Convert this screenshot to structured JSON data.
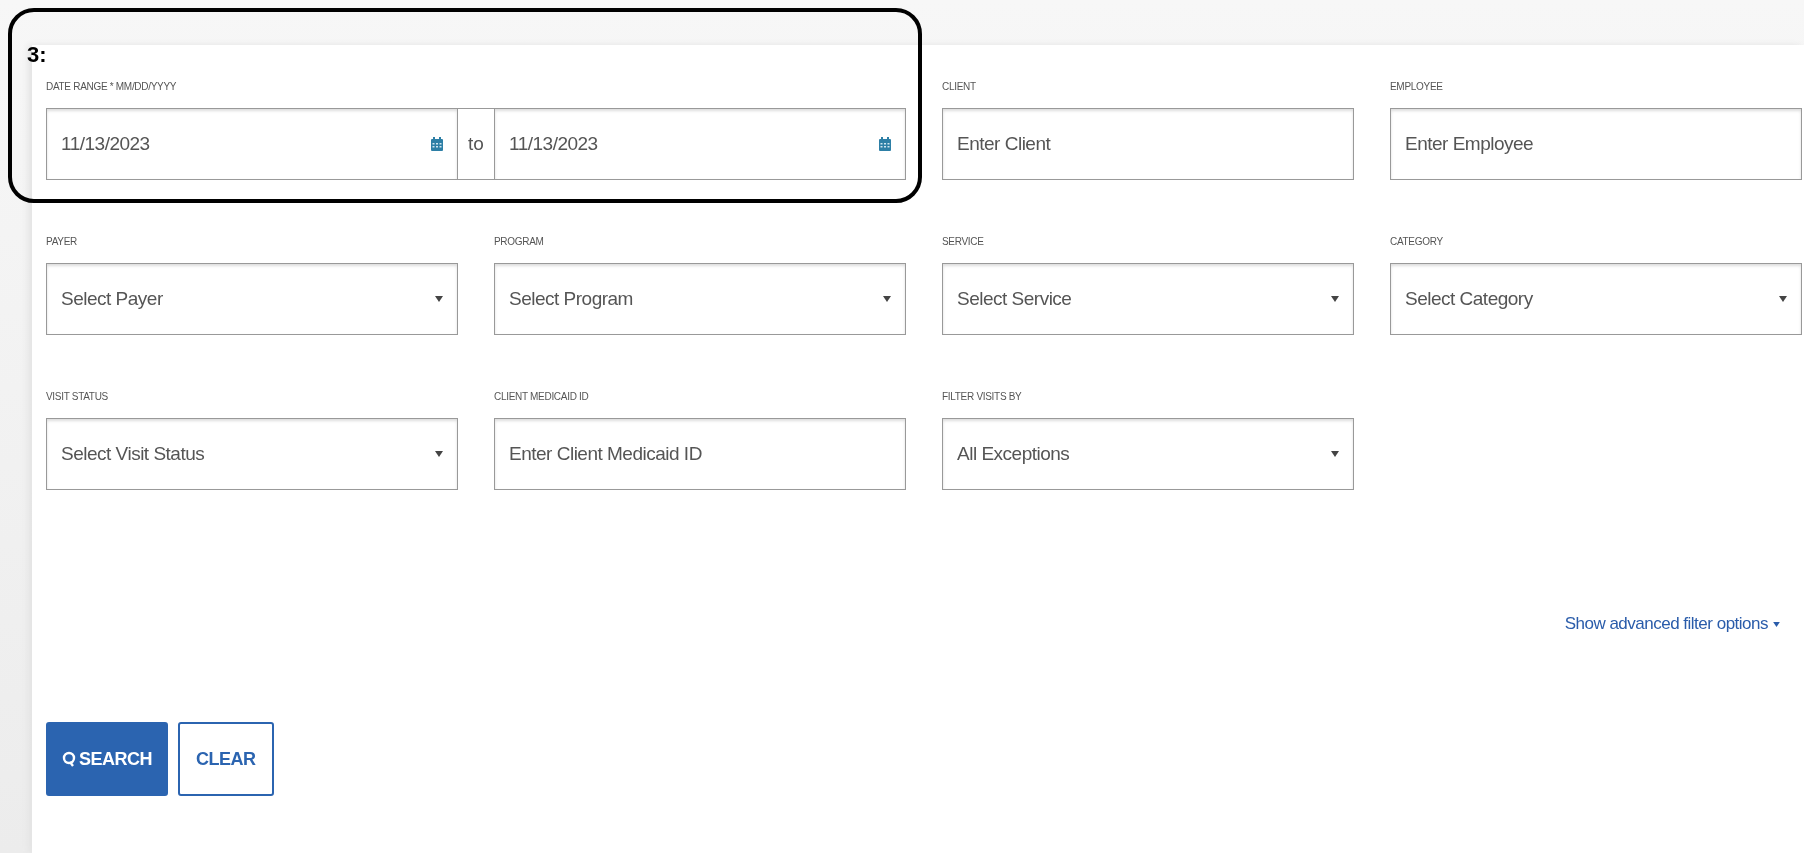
{
  "callout": {
    "label": "3:"
  },
  "rows": [
    [
      {
        "kind": "date_range",
        "label": "DATE RANGE * MM/DD/YYYY",
        "from": "11/13/2023",
        "separator": "to",
        "to": "11/13/2023"
      },
      {
        "kind": "text",
        "label": "CLIENT",
        "placeholder": "Enter Client"
      },
      {
        "kind": "text",
        "label": "EMPLOYEE",
        "placeholder": "Enter Employee"
      }
    ],
    [
      {
        "kind": "select",
        "label": "PAYER",
        "placeholder": "Select Payer"
      },
      {
        "kind": "select",
        "label": "PROGRAM",
        "placeholder": "Select Program"
      },
      {
        "kind": "select",
        "label": "SERVICE",
        "placeholder": "Select Service"
      },
      {
        "kind": "select",
        "label": "CATEGORY",
        "placeholder": "Select Category"
      }
    ],
    [
      {
        "kind": "select",
        "label": "VISIT STATUS",
        "placeholder": "Select Visit Status"
      },
      {
        "kind": "text",
        "label": "CLIENT MEDICAID ID",
        "placeholder": "Enter Client Medicaid ID"
      },
      {
        "kind": "select",
        "label": "FILTER VISITS BY",
        "value": "All Exceptions"
      }
    ]
  ],
  "advanced_link": "Show advanced filter options",
  "buttons": [
    {
      "kind": "primary",
      "label": "SEARCH"
    },
    {
      "kind": "secondary",
      "label": "CLEAR"
    }
  ]
}
